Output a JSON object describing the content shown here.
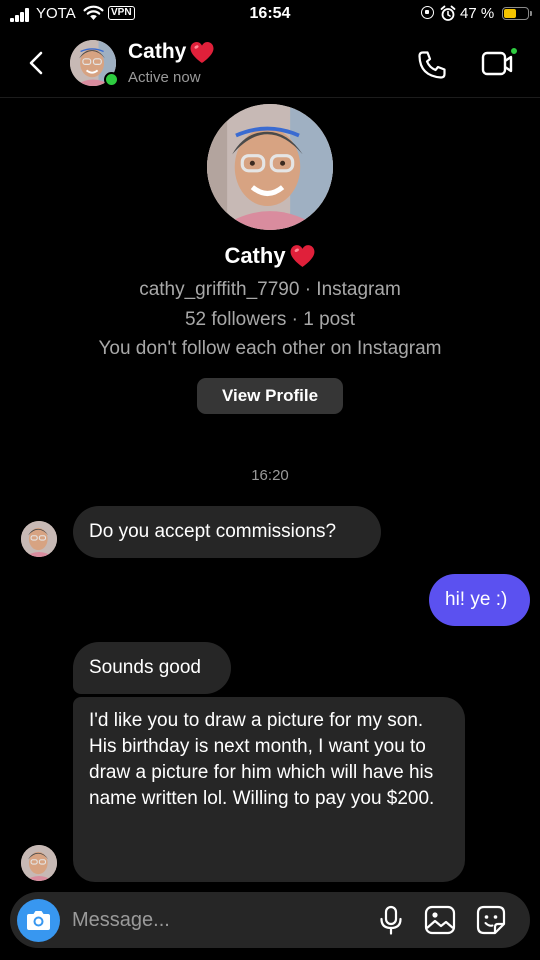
{
  "status_bar": {
    "carrier": "YOTA",
    "vpn": "VPN",
    "time": "16:54",
    "battery_pct": "47 %",
    "battery_level": 0.47,
    "battery_color": "#f5c400"
  },
  "header": {
    "name": "Cathy",
    "status": "Active now",
    "online_color": "#2ecc40"
  },
  "profile": {
    "name": "Cathy",
    "username_line": "cathy_griffith_7790 · Instagram",
    "stats_line": "52 followers · 1 post",
    "follow_line": "You don't follow each other on Instagram",
    "view_profile_label": "View Profile"
  },
  "thread": {
    "timestamp": "16:20",
    "messages": [
      {
        "from": "them",
        "text": "Do you accept commissions?"
      },
      {
        "from": "me",
        "text": "hi! ye :)"
      },
      {
        "from": "them",
        "text": "Sounds good"
      },
      {
        "from": "them",
        "text_lines": [
          "I'd like you to draw a picture for my son.",
          "His birthday is next month, I want you to draw a picture for him which will have his name written lol. Willing to pay you $200."
        ]
      }
    ],
    "sent_bubble_color": "#5b51f0",
    "received_bubble_color": "#262626"
  },
  "composer": {
    "placeholder": "Message...",
    "icons": [
      "camera-icon",
      "microphone-icon",
      "gallery-icon",
      "sticker-icon"
    ],
    "camera_color": "#3897f0"
  },
  "icons": {
    "heart": "heart-icon",
    "back": "chevron-left-icon",
    "call": "phone-icon",
    "video": "video-call-icon"
  }
}
